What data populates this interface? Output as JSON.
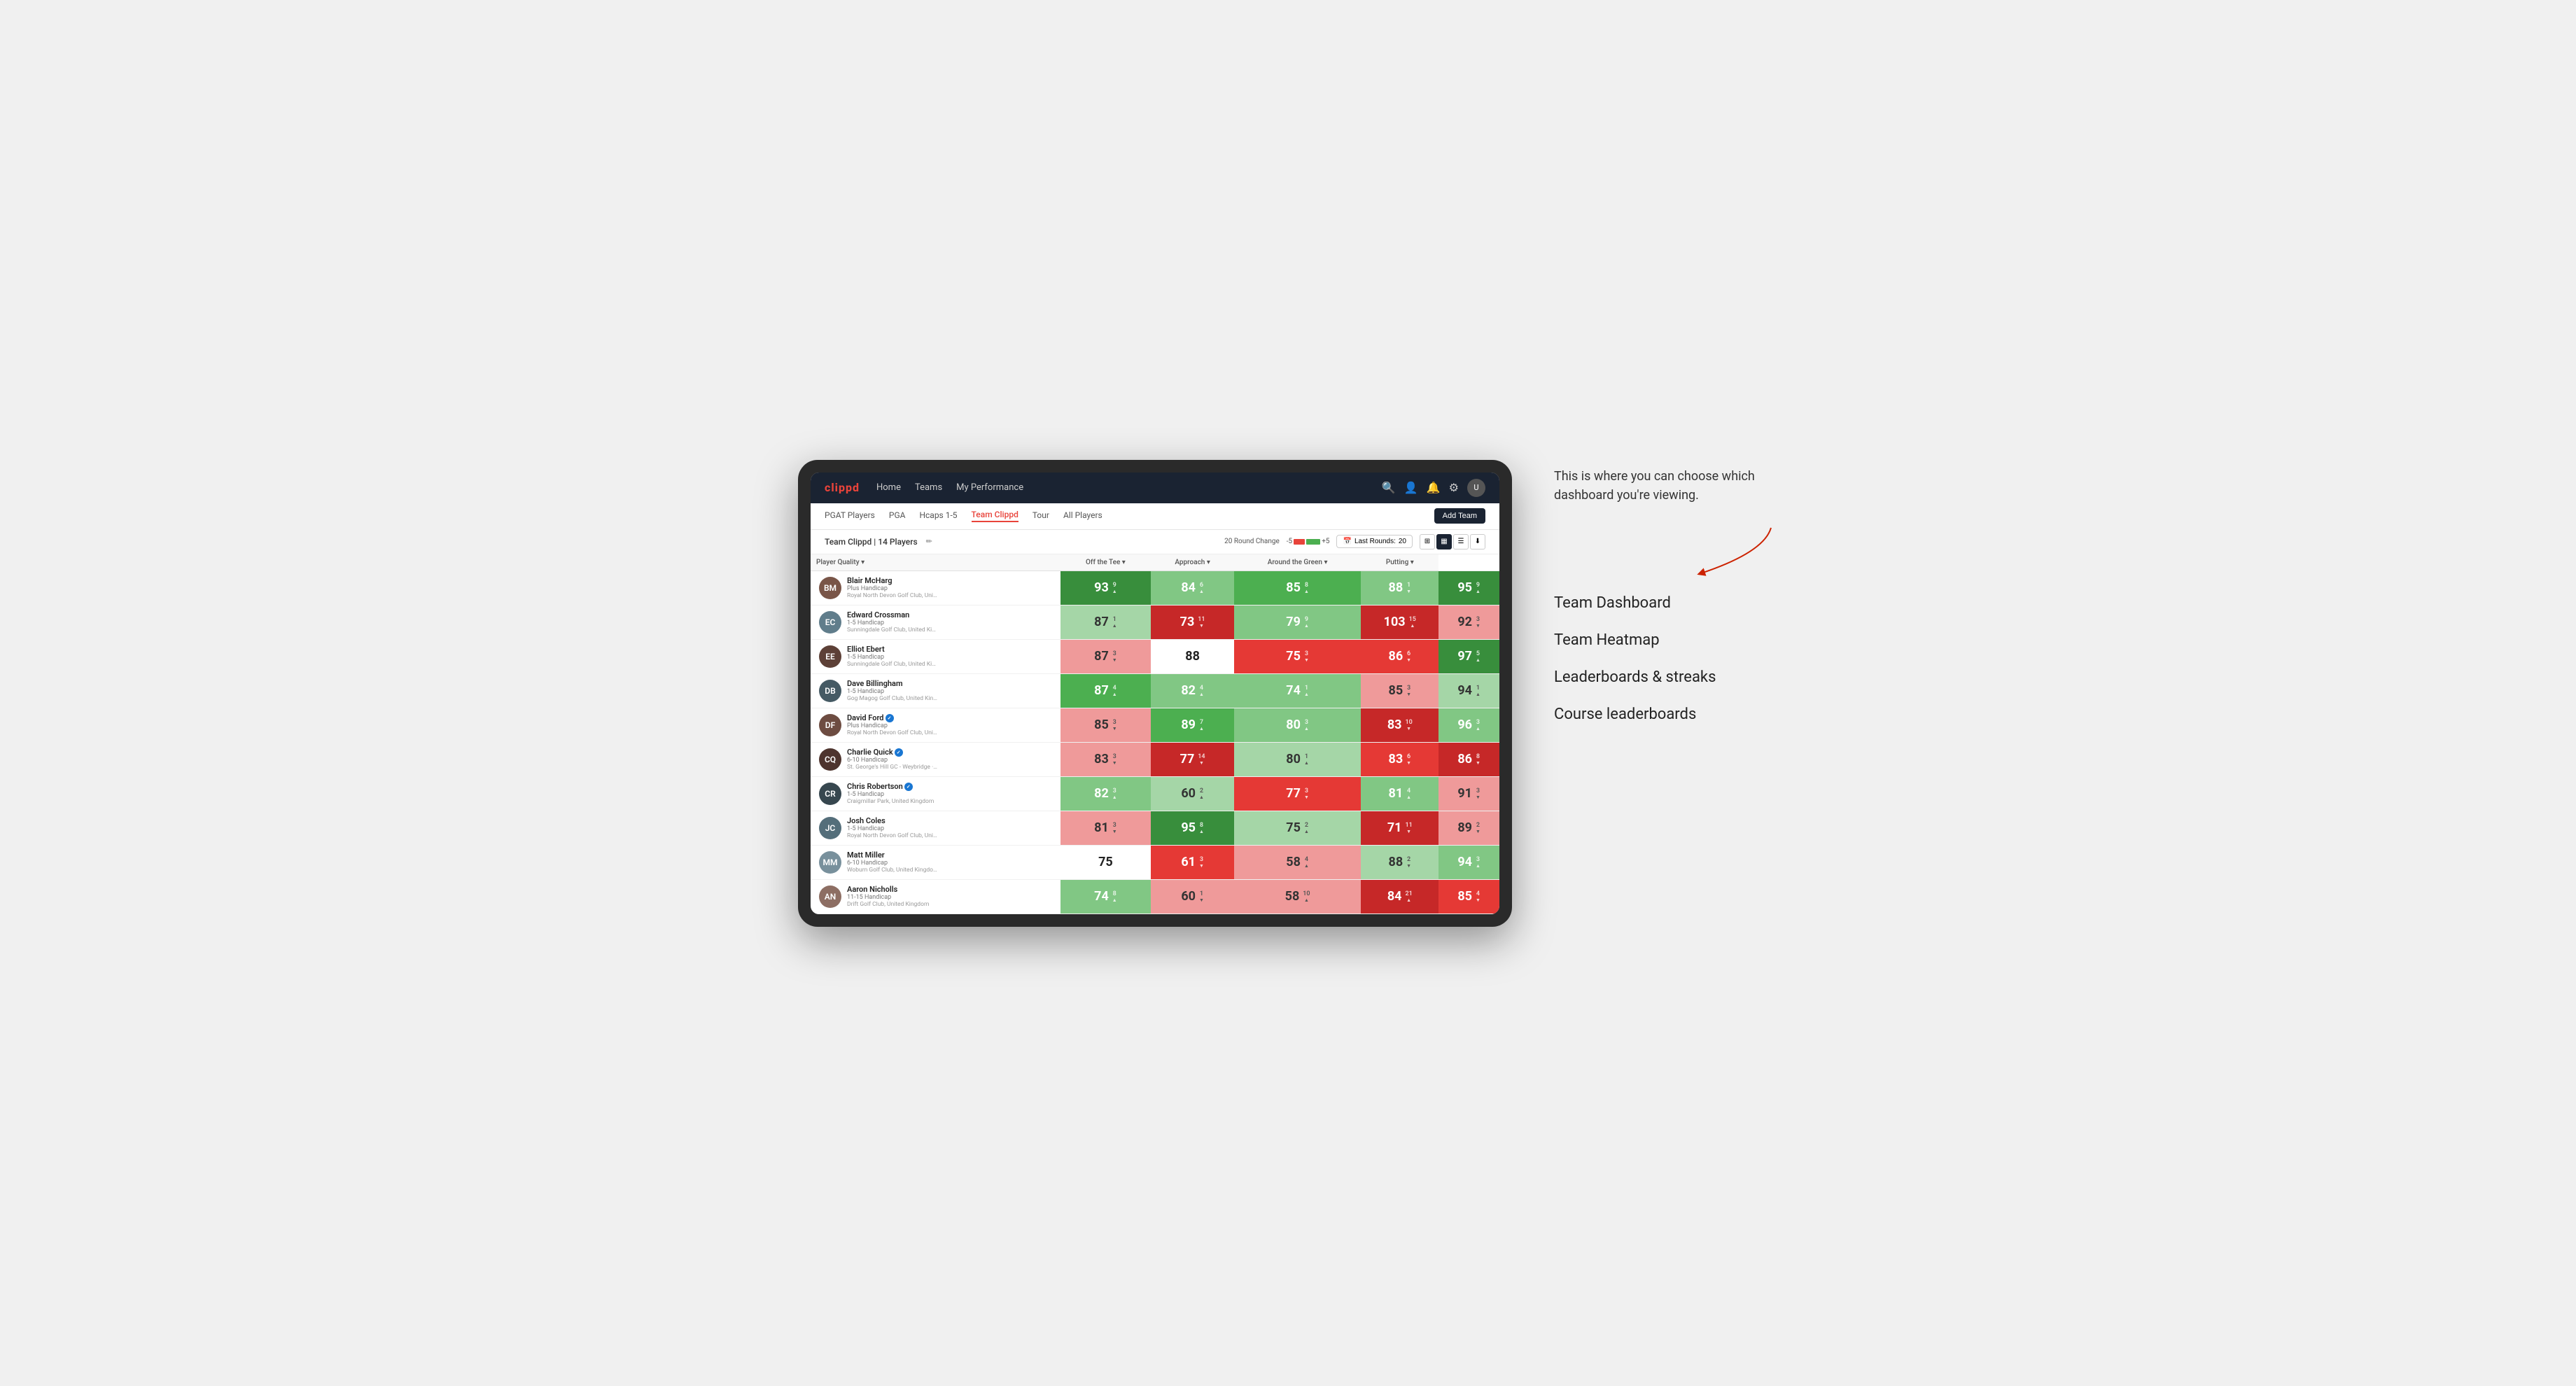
{
  "annotation": {
    "text": "This is where you can choose which dashboard you're viewing.",
    "arrow_label": "→"
  },
  "menu": {
    "options": [
      {
        "id": "team-dashboard",
        "label": "Team Dashboard"
      },
      {
        "id": "team-heatmap",
        "label": "Team Heatmap"
      },
      {
        "id": "leaderboards",
        "label": "Leaderboards & streaks"
      },
      {
        "id": "course-leaderboards",
        "label": "Course leaderboards"
      }
    ]
  },
  "nav": {
    "logo": "clippd",
    "links": [
      "Home",
      "Teams",
      "My Performance"
    ],
    "icons": [
      "search",
      "person",
      "bell",
      "settings",
      "avatar"
    ]
  },
  "sub_nav": {
    "items": [
      {
        "label": "PGAT Players",
        "active": false
      },
      {
        "label": "PGA",
        "active": false
      },
      {
        "label": "Hcaps 1-5",
        "active": false
      },
      {
        "label": "Team Clippd",
        "active": true
      },
      {
        "label": "Tour",
        "active": false
      },
      {
        "label": "All Players",
        "active": false
      }
    ],
    "add_team_label": "Add Team"
  },
  "team_header": {
    "title": "Team Clippd",
    "player_count": "14 Players",
    "round_change_label": "20 Round Change",
    "round_change_neg": "-5",
    "round_change_pos": "+5",
    "last_rounds_label": "Last Rounds:",
    "last_rounds_value": "20"
  },
  "table": {
    "col_headers": [
      "Player Quality ▾",
      "Off the Tee ▾",
      "Approach ▾",
      "Around the Green ▾",
      "Putting ▾"
    ],
    "players": [
      {
        "name": "Blair McHarg",
        "handicap": "Plus Handicap",
        "club": "Royal North Devon Golf Club, United Kingdom",
        "avatar_initials": "BM",
        "avatar_color": "#795548",
        "scores": [
          {
            "value": "93",
            "change": "9",
            "dir": "up",
            "bg": "green-dark"
          },
          {
            "value": "84",
            "change": "6",
            "dir": "up",
            "bg": "green-light"
          },
          {
            "value": "85",
            "change": "8",
            "dir": "up",
            "bg": "green-mid"
          },
          {
            "value": "88",
            "change": "1",
            "dir": "down",
            "bg": "green-light"
          },
          {
            "value": "95",
            "change": "9",
            "dir": "up",
            "bg": "green-dark"
          }
        ]
      },
      {
        "name": "Edward Crossman",
        "handicap": "1-5 Handicap",
        "club": "Sunningdale Golf Club, United Kingdom",
        "avatar_initials": "EC",
        "avatar_color": "#607d8b",
        "scores": [
          {
            "value": "87",
            "change": "1",
            "dir": "up",
            "bg": "green-pale"
          },
          {
            "value": "73",
            "change": "11",
            "dir": "down",
            "bg": "red-dark"
          },
          {
            "value": "79",
            "change": "9",
            "dir": "up",
            "bg": "green-light"
          },
          {
            "value": "103",
            "change": "15",
            "dir": "up",
            "bg": "red-dark"
          },
          {
            "value": "92",
            "change": "3",
            "dir": "down",
            "bg": "red-light"
          }
        ]
      },
      {
        "name": "Elliot Ebert",
        "handicap": "1-5 Handicap",
        "club": "Sunningdale Golf Club, United Kingdom",
        "avatar_initials": "EE",
        "avatar_color": "#5d4037",
        "scores": [
          {
            "value": "87",
            "change": "3",
            "dir": "down",
            "bg": "red-light"
          },
          {
            "value": "88",
            "change": "",
            "dir": "neutral",
            "bg": "white"
          },
          {
            "value": "75",
            "change": "3",
            "dir": "down",
            "bg": "red-mid"
          },
          {
            "value": "86",
            "change": "6",
            "dir": "down",
            "bg": "red-mid"
          },
          {
            "value": "97",
            "change": "5",
            "dir": "up",
            "bg": "green-dark"
          }
        ]
      },
      {
        "name": "Dave Billingham",
        "handicap": "1-5 Handicap",
        "club": "Gog Magog Golf Club, United Kingdom",
        "avatar_initials": "DB",
        "avatar_color": "#455a64",
        "scores": [
          {
            "value": "87",
            "change": "4",
            "dir": "up",
            "bg": "green-mid"
          },
          {
            "value": "82",
            "change": "4",
            "dir": "up",
            "bg": "green-light"
          },
          {
            "value": "74",
            "change": "1",
            "dir": "up",
            "bg": "green-light"
          },
          {
            "value": "85",
            "change": "3",
            "dir": "down",
            "bg": "red-light"
          },
          {
            "value": "94",
            "change": "1",
            "dir": "up",
            "bg": "green-pale"
          }
        ]
      },
      {
        "name": "David Ford",
        "handicap": "Plus Handicap",
        "club": "Royal North Devon Golf Club, United Kingdom",
        "avatar_initials": "DF",
        "avatar_color": "#6d4c41",
        "verified": true,
        "scores": [
          {
            "value": "85",
            "change": "3",
            "dir": "down",
            "bg": "red-light"
          },
          {
            "value": "89",
            "change": "7",
            "dir": "up",
            "bg": "green-mid"
          },
          {
            "value": "80",
            "change": "3",
            "dir": "up",
            "bg": "green-light"
          },
          {
            "value": "83",
            "change": "10",
            "dir": "down",
            "bg": "red-dark"
          },
          {
            "value": "96",
            "change": "3",
            "dir": "up",
            "bg": "green-light"
          }
        ]
      },
      {
        "name": "Charlie Quick",
        "handicap": "6-10 Handicap",
        "club": "St. George's Hill GC - Weybridge · Surrey, Uni...",
        "avatar_initials": "CQ",
        "avatar_color": "#4e342e",
        "verified": true,
        "scores": [
          {
            "value": "83",
            "change": "3",
            "dir": "down",
            "bg": "red-light"
          },
          {
            "value": "77",
            "change": "14",
            "dir": "down",
            "bg": "red-dark"
          },
          {
            "value": "80",
            "change": "1",
            "dir": "up",
            "bg": "green-pale"
          },
          {
            "value": "83",
            "change": "6",
            "dir": "down",
            "bg": "red-mid"
          },
          {
            "value": "86",
            "change": "8",
            "dir": "down",
            "bg": "red-dark"
          }
        ]
      },
      {
        "name": "Chris Robertson",
        "handicap": "1-5 Handicap",
        "club": "Craigmillar Park, United Kingdom",
        "avatar_initials": "CR",
        "avatar_color": "#37474f",
        "verified": true,
        "scores": [
          {
            "value": "82",
            "change": "3",
            "dir": "up",
            "bg": "green-light"
          },
          {
            "value": "60",
            "change": "2",
            "dir": "up",
            "bg": "green-pale"
          },
          {
            "value": "77",
            "change": "3",
            "dir": "down",
            "bg": "red-mid"
          },
          {
            "value": "81",
            "change": "4",
            "dir": "up",
            "bg": "green-light"
          },
          {
            "value": "91",
            "change": "3",
            "dir": "down",
            "bg": "red-light"
          }
        ]
      },
      {
        "name": "Josh Coles",
        "handicap": "1-5 Handicap",
        "club": "Royal North Devon Golf Club, United Kingdom",
        "avatar_initials": "JC",
        "avatar_color": "#546e7a",
        "scores": [
          {
            "value": "81",
            "change": "3",
            "dir": "down",
            "bg": "red-light"
          },
          {
            "value": "95",
            "change": "8",
            "dir": "up",
            "bg": "green-dark"
          },
          {
            "value": "75",
            "change": "2",
            "dir": "up",
            "bg": "green-pale"
          },
          {
            "value": "71",
            "change": "11",
            "dir": "down",
            "bg": "red-dark"
          },
          {
            "value": "89",
            "change": "2",
            "dir": "down",
            "bg": "red-light"
          }
        ]
      },
      {
        "name": "Matt Miller",
        "handicap": "6-10 Handicap",
        "club": "Woburn Golf Club, United Kingdom",
        "avatar_initials": "MM",
        "avatar_color": "#78909c",
        "scores": [
          {
            "value": "75",
            "change": "",
            "dir": "neutral",
            "bg": "white"
          },
          {
            "value": "61",
            "change": "3",
            "dir": "down",
            "bg": "red-mid"
          },
          {
            "value": "58",
            "change": "4",
            "dir": "up",
            "bg": "red-light"
          },
          {
            "value": "88",
            "change": "2",
            "dir": "down",
            "bg": "green-pale"
          },
          {
            "value": "94",
            "change": "3",
            "dir": "up",
            "bg": "green-light"
          }
        ]
      },
      {
        "name": "Aaron Nicholls",
        "handicap": "11-15 Handicap",
        "club": "Drift Golf Club, United Kingdom",
        "avatar_initials": "AN",
        "avatar_color": "#8d6e63",
        "scores": [
          {
            "value": "74",
            "change": "8",
            "dir": "up",
            "bg": "green-light"
          },
          {
            "value": "60",
            "change": "1",
            "dir": "down",
            "bg": "red-light"
          },
          {
            "value": "58",
            "change": "10",
            "dir": "up",
            "bg": "red-light"
          },
          {
            "value": "84",
            "change": "21",
            "dir": "up",
            "bg": "red-dark"
          },
          {
            "value": "85",
            "change": "4",
            "dir": "down",
            "bg": "red-mid"
          }
        ]
      }
    ]
  }
}
